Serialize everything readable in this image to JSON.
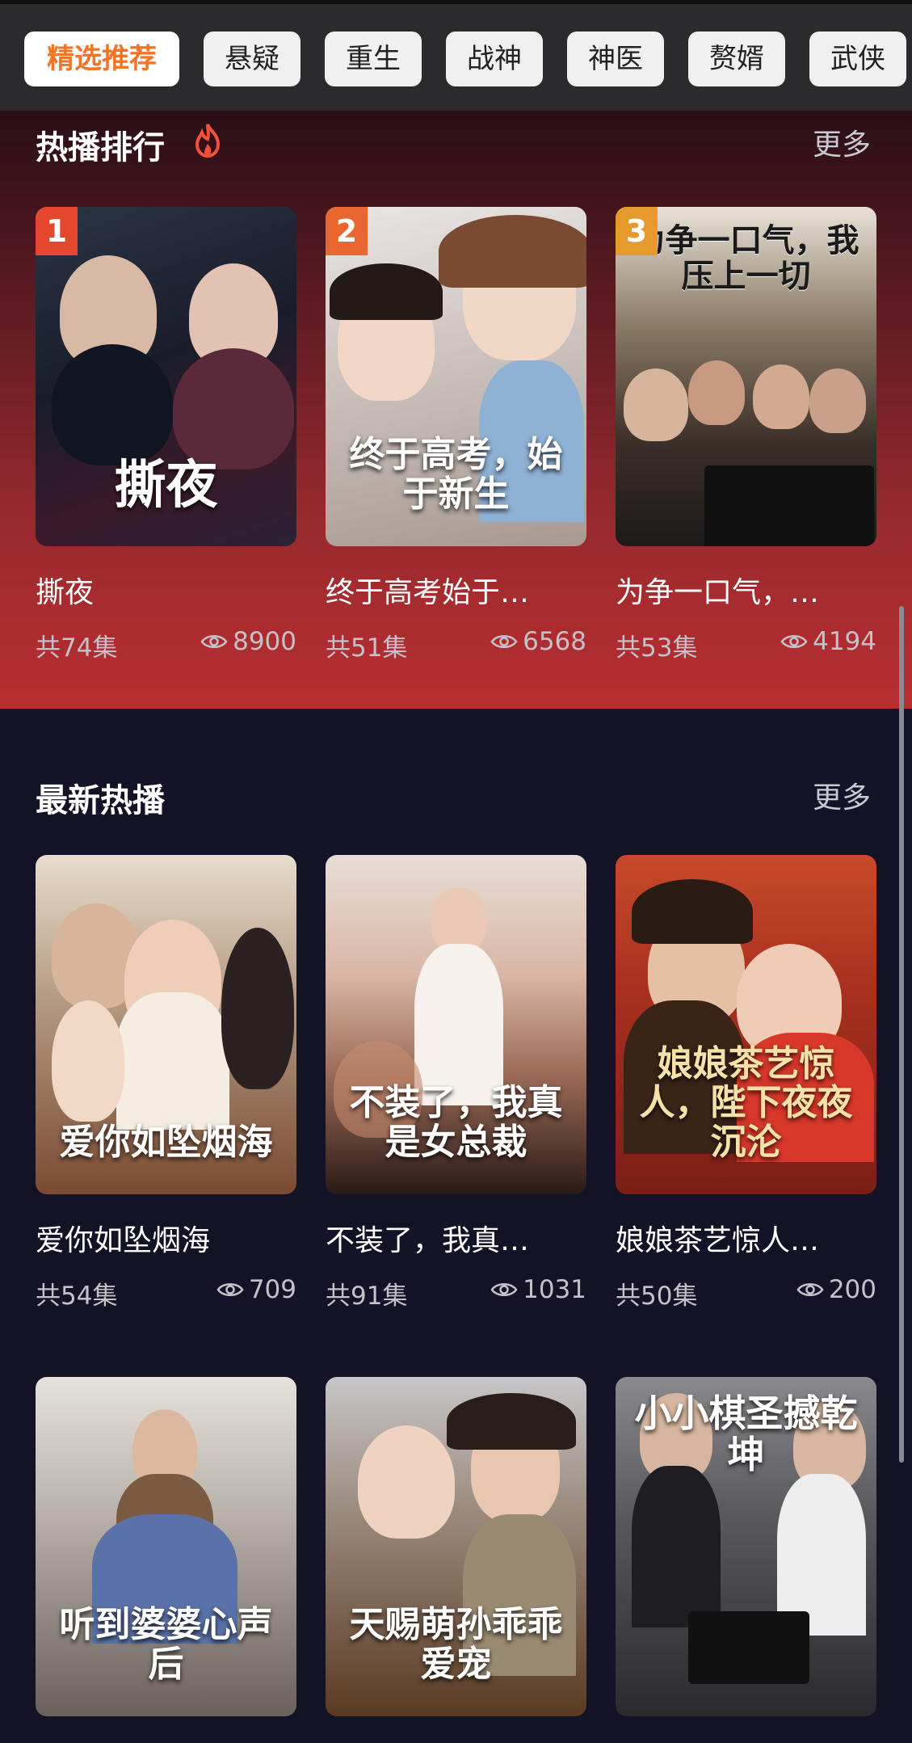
{
  "tabs": [
    {
      "label": "精选推荐",
      "active": true
    },
    {
      "label": "悬疑"
    },
    {
      "label": "重生"
    },
    {
      "label": "战神"
    },
    {
      "label": "神医"
    },
    {
      "label": "赘婿"
    },
    {
      "label": "武侠"
    }
  ],
  "hot": {
    "title": "热播排行",
    "more": "更多",
    "items": [
      {
        "rank": "1",
        "name": "撕夜",
        "episodes": "共74集",
        "views": "8900",
        "poster_text": "撕夜"
      },
      {
        "rank": "2",
        "name": "终于高考始于…",
        "episodes": "共51集",
        "views": "6568",
        "poster_text": "终于高考，始于新生"
      },
      {
        "rank": "3",
        "name": "为争一口气，…",
        "episodes": "共53集",
        "views": "4194",
        "poster_text": "为争一口气，我压上一切"
      }
    ]
  },
  "latest": {
    "title": "最新热播",
    "more": "更多",
    "items": [
      {
        "name": "爱你如坠烟海",
        "episodes": "共54集",
        "views": "709",
        "poster_text": "爱你如坠烟海"
      },
      {
        "name": "不装了，我真…",
        "episodes": "共91集",
        "views": "1031",
        "poster_text": "不装了，我真是女总裁"
      },
      {
        "name": "娘娘茶艺惊人…",
        "episodes": "共50集",
        "views": "200",
        "poster_text": "娘娘茶艺惊人，陛下夜夜沉沦"
      },
      {
        "poster_text": "听到婆婆心声后"
      },
      {
        "poster_text": "天赐萌孙乖乖爱宠"
      },
      {
        "poster_text": "小小棋圣撼乾坤"
      }
    ]
  },
  "colors": {
    "accent": "#f47427",
    "rank1": "#e5472e",
    "rank2": "#e9662f",
    "rank3": "#e69a2e"
  }
}
